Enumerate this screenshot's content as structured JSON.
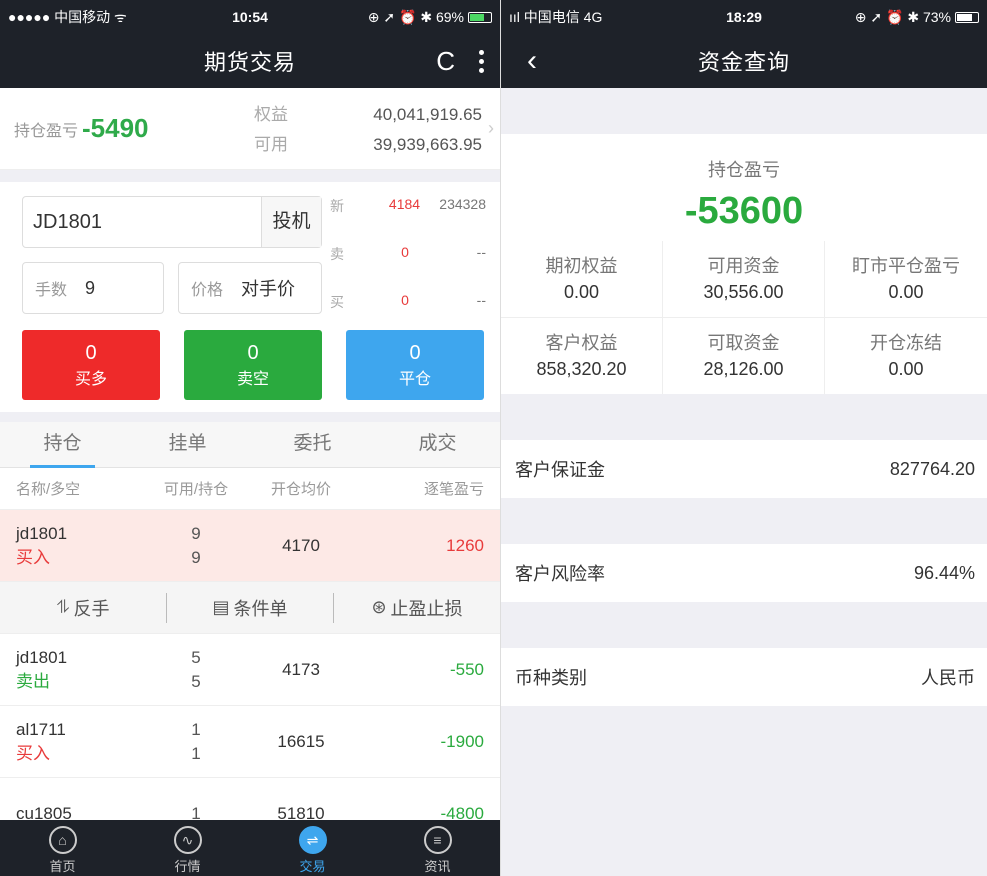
{
  "left": {
    "status": {
      "carrier": "●●●●● 中国移动 ᯤ",
      "time": "10:54",
      "right": "⊕ ➚ ⏰ ✱ 69%",
      "battery_level": 0.69
    },
    "nav": {
      "title": "期货交易",
      "refresh_icon": "C"
    },
    "summary": {
      "pl_label": "持仓盈亏",
      "pl_value": "-5490",
      "equity_label": "权益",
      "equity_value": "40,041,919.65",
      "avail_label": "可用",
      "avail_value": "39,939,663.95"
    },
    "order": {
      "code": "JD1801",
      "type": "投机",
      "qty_label": "手数",
      "qty_value": "9",
      "price_label": "价格",
      "price_value": "对手价",
      "quotes": [
        {
          "label": "新",
          "price": "4184",
          "vol": "234328"
        },
        {
          "label": "卖",
          "price": "0",
          "vol": "--"
        },
        {
          "label": "买",
          "price": "0",
          "vol": "--"
        }
      ],
      "buttons": [
        {
          "num": "0",
          "label": "买多"
        },
        {
          "num": "0",
          "label": "卖空"
        },
        {
          "num": "0",
          "label": "平仓"
        }
      ]
    },
    "tabs": [
      "持仓",
      "挂单",
      "委托",
      "成交"
    ],
    "table": {
      "headers": [
        "名称/多空",
        "可用/持仓",
        "开仓均价",
        "逐笔盈亏"
      ],
      "rows": [
        {
          "name": "jd1801",
          "dir": "买入",
          "avail": "9",
          "hold": "9",
          "price": "4170",
          "pl": "1260"
        },
        {
          "name": "jd1801",
          "dir": "卖出",
          "avail": "5",
          "hold": "5",
          "price": "4173",
          "pl": "-550"
        },
        {
          "name": "al1711",
          "dir": "买入",
          "avail": "1",
          "hold": "1",
          "price": "16615",
          "pl": "-1900"
        },
        {
          "name": "cu1805",
          "dir": "",
          "avail": "1",
          "hold": "",
          "price": "51810",
          "pl": "-4800"
        }
      ],
      "actions": [
        "反手",
        "条件单",
        "止盈止损"
      ]
    },
    "tabbar": [
      "首页",
      "行情",
      "交易",
      "资讯"
    ]
  },
  "right": {
    "status": {
      "carrier": "ııl 中国电信  4G",
      "time": "18:29",
      "right": "⊕ ➚ ⏰ ✱ 73%",
      "battery_level": 0.73
    },
    "nav": {
      "title": "资金查询"
    },
    "hold_label": "持仓盈亏",
    "hold_value": "-53600",
    "grid": [
      {
        "k": "期初权益",
        "v": "0.00"
      },
      {
        "k": "可用资金",
        "v": "30,556.00"
      },
      {
        "k": "盯市平仓盈亏",
        "v": "0.00"
      },
      {
        "k": "客户权益",
        "v": "858,320.20"
      },
      {
        "k": "可取资金",
        "v": "28,126.00"
      },
      {
        "k": "开仓冻结",
        "v": "0.00"
      }
    ],
    "info": [
      {
        "k": "客户保证金",
        "v": "827764.20"
      },
      {
        "k": "客户风险率",
        "v": "96.44%"
      },
      {
        "k": "币种类别",
        "v": "人民币"
      }
    ]
  }
}
